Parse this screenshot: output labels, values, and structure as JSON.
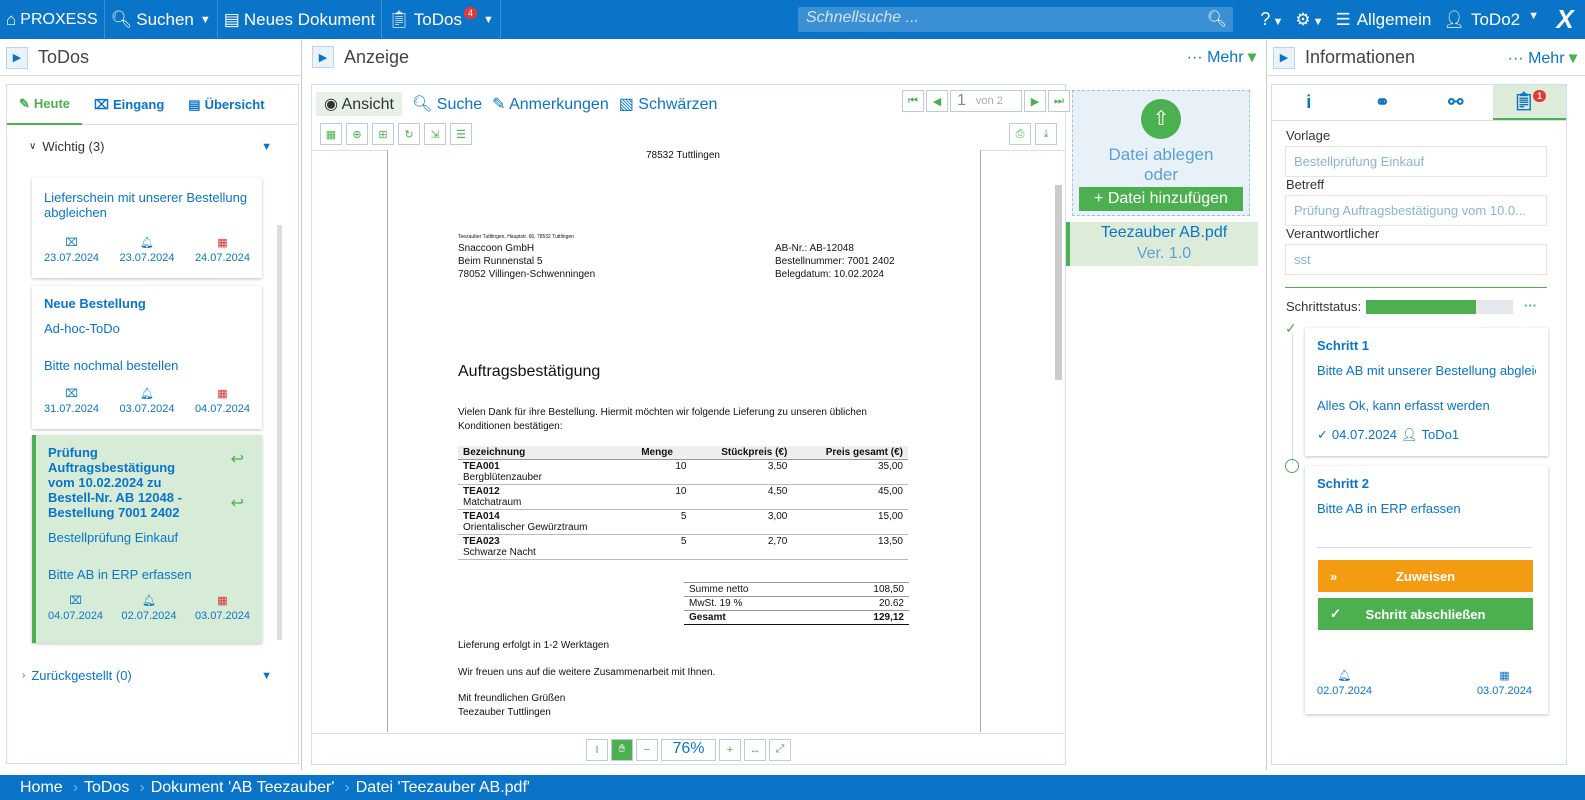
{
  "topbar": {
    "logo": "PROXESS",
    "search": "Suchen",
    "newdoc": "Neues Dokument",
    "todos": "ToDos",
    "todos_badge": "4",
    "quicksearch": "Schnellsuche ...",
    "help": "?",
    "db": "Allgemein",
    "user": "ToDo2"
  },
  "left": {
    "title": "ToDos",
    "tab_today": "Heute",
    "tab_inbox": "Eingang",
    "tab_overview": "Übersicht",
    "group1": "Wichtig (3)",
    "group2": "Zurückgestellt (0)",
    "cards": [
      {
        "title": "",
        "line1": "Lieferschein mit unserer Bestellung abgleichen",
        "line2": "",
        "d1": "23.07.2024",
        "d2": "23.07.2024",
        "d3": "24.07.2024"
      },
      {
        "title": "Neue Bestellung",
        "line1": "Ad-hoc-ToDo",
        "line2": "Bitte nochmal bestellen",
        "d1": "31.07.2024",
        "d2": "03.07.2024",
        "d3": "04.07.2024"
      },
      {
        "title": "Prüfung Auftragsbestätigung vom 10.02.2024 zu Bestell-Nr. AB 12048 - Bestellung 7001 2402",
        "line1": "Bestellprüfung Einkauf",
        "line2": "Bitte AB in ERP erfassen",
        "d1": "04.07.2024",
        "d2": "02.07.2024",
        "d3": "03.07.2024"
      }
    ]
  },
  "center": {
    "title": "Anzeige",
    "more": "Mehr",
    "tab_view": "Ansicht",
    "tab_search": "Suche",
    "tab_notes": "Anmerkungen",
    "tab_redact": "Schwärzen",
    "page": "1",
    "page_of": "von 2",
    "zoom": "76%",
    "drop": "Datei ablegen",
    "or": "oder",
    "add": "Datei hinzufügen",
    "file": "Teezauber AB.pdf",
    "ver": "Ver. 1.0"
  },
  "doc": {
    "topcity": "78532 Tuttlingen",
    "sender": "Teezauber Tuttlingen, Hauptstr. 66, 78532 Tuttlingen",
    "to1": "Snaccoon GmbH",
    "to2": "Beim Runnenstal 5",
    "to3": "78052 Villingen-Schwenningen",
    "ab": "AB-Nr.: AB-12048",
    "bn": "Bestellnummer: 7001 2402",
    "bd": "Belegdatum: 10.02.2024",
    "heading": "Auftragsbestätigung",
    "intro": "Vielen Dank für ihre Bestellung. Hiermit möchten wir folgende Lieferung zu unseren üblichen Konditionen bestätigen:",
    "cols": [
      "Bezeichnung",
      "Menge",
      "Stückpreis (€)",
      "Preis gesamt (€)"
    ],
    "rows": [
      [
        "TEA001",
        "Bergblütenzauber",
        "10",
        "3,50",
        "35,00"
      ],
      [
        "TEA012",
        "Matchatraum",
        "10",
        "4,50",
        "45,00"
      ],
      [
        "TEA014",
        "Orientalischer Gewürztraum",
        "5",
        "3,00",
        "15,00"
      ],
      [
        "TEA023",
        "Schwarze Nacht",
        "5",
        "2,70",
        "13,50"
      ]
    ],
    "sum": [
      [
        "Summe netto",
        "108,50"
      ],
      [
        "MwSt. 19 %",
        "20.62"
      ],
      [
        "Gesamt",
        "129,12"
      ]
    ],
    "l1": "Lieferung erfolgt in 1-2 Werktagen",
    "l2": "Wir freuen uns auf die weitere Zusammenarbeit mit Ihnen.",
    "l3": "Mit freundlichen Grüßen",
    "l4": "Teezauber Tuttlingen"
  },
  "info": {
    "title": "Informationen",
    "more": "Mehr",
    "badge": "1",
    "vorlage_l": "Vorlage",
    "vorlage": "Bestellprüfung Einkauf",
    "betreff_l": "Betreff",
    "betreff": "Prüfung Auftragsbestätigung vom 10.0...",
    "verant_l": "Verantwortlicher",
    "verant": "sst",
    "status_l": "Schrittstatus:",
    "progress": 0.75,
    "s1_title": "Schritt 1",
    "s1_text": "Bitte AB mit unserer Bestellung abgleic",
    "s1_note": "Alles Ok, kann erfasst werden",
    "s1_date": "04.07.2024",
    "s1_user": "ToDo1",
    "s2_title": "Schritt 2",
    "s2_text": "Bitte AB in ERP erfassen",
    "assign": "Zuweisen",
    "finish": "Schritt abschließen",
    "s2_d1": "02.07.2024",
    "s2_d2": "03.07.2024"
  },
  "breadcrumb": [
    "Home",
    "ToDos",
    "Dokument 'AB Teezauber'",
    "Datei 'Teezauber AB.pdf'"
  ]
}
